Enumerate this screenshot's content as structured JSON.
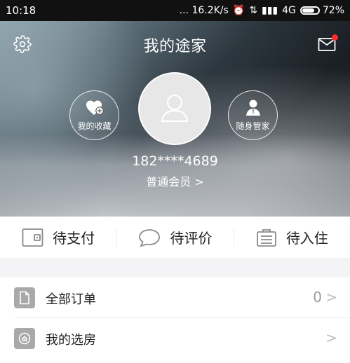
{
  "status_bar": {
    "time": "10:18",
    "network_speed": "... 16.2K/s",
    "signal": "4G",
    "battery_percent": "72%",
    "battery_level": 72
  },
  "header": {
    "title": "我的途家"
  },
  "profile": {
    "favorites_label": "我的收藏",
    "butler_label": "随身管家",
    "phone": "182****4689",
    "member_level": "普通会员 >"
  },
  "order_status": {
    "items": [
      {
        "label": "待支付"
      },
      {
        "label": "待评价"
      },
      {
        "label": "待入住"
      }
    ]
  },
  "menu": {
    "items": [
      {
        "label": "全部订单",
        "value": "0",
        "arrow": ">"
      },
      {
        "label": "我的选房",
        "value": "",
        "arrow": ">"
      }
    ]
  },
  "colors": {
    "accent_dot": "#ff2b2b",
    "background": "#f3f3f5"
  },
  "icons": {
    "settings": "settings-icon",
    "mail": "mail-icon",
    "favorites": "heart-plus-icon",
    "butler": "butler-icon",
    "avatar": "user-avatar-icon",
    "pending_payment": "wallet-icon",
    "pending_review": "chat-bubble-icon",
    "pending_checkin": "suitcase-icon",
    "all_orders": "document-icon",
    "my_selected_rooms": "house-search-icon"
  }
}
